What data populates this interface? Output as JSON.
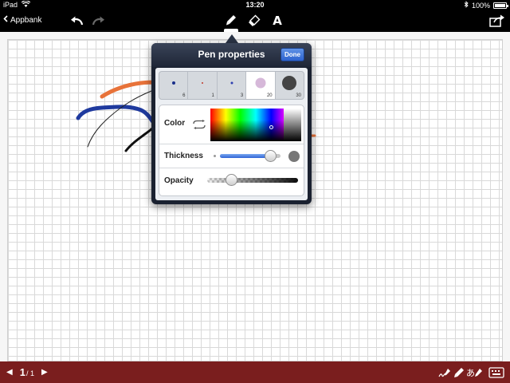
{
  "status_bar": {
    "carrier": "iPad",
    "time": "13:20",
    "battery": "100%",
    "battery_level": 1.0
  },
  "toolbar": {
    "back_label": "Appbank",
    "icons": [
      "undo-icon",
      "redo-icon",
      "pen-icon",
      "eraser-icon",
      "text-tool-icon",
      "share-icon"
    ],
    "text_tool_label": "A",
    "active_tool": "pen"
  },
  "popover": {
    "title": "Pen properties",
    "done_label": "Done",
    "sizes": [
      {
        "label": "6",
        "color": "#1a2f8a"
      },
      {
        "label": "1",
        "color": "#c0392b"
      },
      {
        "label": "3",
        "color": "#2c3eb0"
      },
      {
        "label": "20",
        "color": "#d6b8d9"
      },
      {
        "label": "30",
        "color": "#444444"
      }
    ],
    "selected_size": "20",
    "color_label": "Color",
    "thickness_label": "Thickness",
    "thickness_level": 0.84,
    "opacity_label": "Opacity",
    "opacity_level": 0.27
  },
  "bottom_bar": {
    "current_page": "1",
    "total_pages": "/ 1",
    "bar_color": "#7a1e1e",
    "icons": [
      "handwriting-icon",
      "pen-icon",
      "japanese-input-icon",
      "keyboard-icon"
    ],
    "japanese_label": "あ"
  },
  "canvas": {
    "background": "grid",
    "stroke_colors": [
      "#e8733a",
      "#1f3a9e",
      "#222222",
      "#111111"
    ]
  }
}
